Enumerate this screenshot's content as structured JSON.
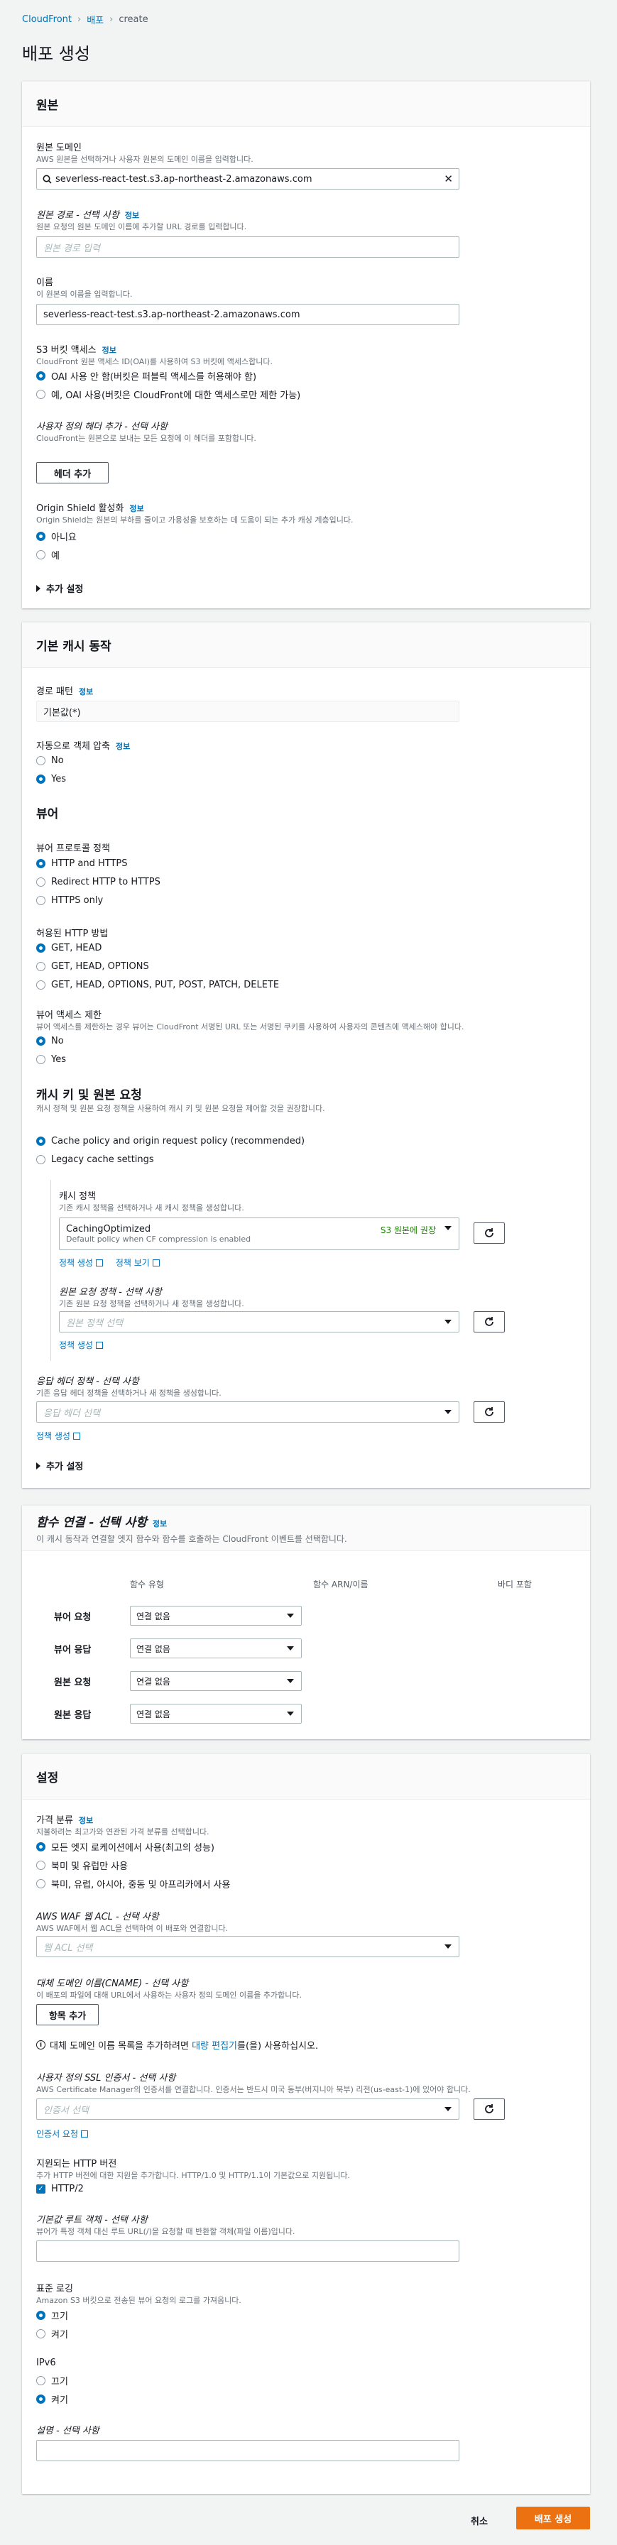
{
  "breadcrumb": {
    "items": [
      "CloudFront",
      "배포",
      "create"
    ]
  },
  "page_title": "배포 생성",
  "origin": {
    "title": "원본",
    "domain": {
      "label": "원본 도메인",
      "desc": "AWS 원본을 선택하거나 사용자 원본의 도메인 이름을 입력합니다.",
      "value": "severless-react-test.s3.ap-northeast-2.amazonaws.com"
    },
    "path": {
      "label": "원본 경로 - 선택 사항",
      "info": "정보",
      "desc": "원본 요청의 원본 도메인 이름에 추가할 URL 경로를 입력합니다.",
      "placeholder": "원본 경로 입력"
    },
    "name": {
      "label": "이름",
      "desc": "이 원본의 이름을 입력합니다.",
      "value": "severless-react-test.s3.ap-northeast-2.amazonaws.com"
    },
    "s3_access": {
      "label": "S3 버킷 액세스",
      "info": "정보",
      "desc": "CloudFront 원본 액세스 ID(OAI)를 사용하여 S3 버킷에 액세스합니다.",
      "options": [
        "OAI 사용 안 함(버킷은 퍼블릭 액세스를 허용해야 함)",
        "예, OAI 사용(버킷은 CloudFront에 대한 액세스로만 제한 가능)"
      ]
    },
    "headers": {
      "label": "사용자 정의 헤더 추가 - 선택 사항",
      "desc": "CloudFront는 원본으로 보내는 모든 요청에 이 헤더를 포함합니다.",
      "button": "헤더 추가"
    },
    "shield": {
      "label": "Origin Shield 활성화",
      "info": "정보",
      "desc": "Origin Shield는 원본의 부하를 줄이고 가용성을 보호하는 데 도움이 되는 추가 캐싱 계층입니다.",
      "options": [
        "아니요",
        "예"
      ]
    },
    "more": "추가 설정"
  },
  "cache": {
    "title": "기본 캐시 동작",
    "path_pattern": {
      "label": "경로 패턴",
      "info": "정보",
      "value": "기본값(*)"
    },
    "compress": {
      "label": "자동으로 객체 압축",
      "info": "정보",
      "options": [
        "No",
        "Yes"
      ]
    },
    "viewer_title": "뷰어",
    "protocol": {
      "label": "뷰어 프로토콜 정책",
      "options": [
        "HTTP and HTTPS",
        "Redirect HTTP to HTTPS",
        "HTTPS only"
      ]
    },
    "methods": {
      "label": "허용된 HTTP 방법",
      "options": [
        "GET, HEAD",
        "GET, HEAD, OPTIONS",
        "GET, HEAD, OPTIONS, PUT, POST, PATCH, DELETE"
      ]
    },
    "restrict": {
      "label": "뷰어 액세스 제한",
      "desc": "뷰어 액세스를 제한하는 경우 뷰어는 CloudFront 서명된 URL 또는 서명된 쿠키를 사용하여 사용자의 콘텐츠에 액세스해야 합니다.",
      "options": [
        "No",
        "Yes"
      ]
    },
    "key_title": "캐시 키 및 원본 요청",
    "key_desc": "캐시 정책 및 원본 요청 정책을 사용하여 캐시 키 및 원본 요청을 제어할 것을 권장합니다.",
    "key_options": [
      "Cache policy and origin request policy (recommended)",
      "Legacy cache settings"
    ],
    "cache_policy": {
      "label": "캐시 정책",
      "desc": "기존 캐시 정책을 선택하거나 새 캐시 정책을 생성합니다.",
      "value": "CachingOptimized",
      "value_desc": "Default policy when CF compression is enabled",
      "badge": "S3 원본에 권장",
      "links": [
        "정책 생성",
        "정책 보기"
      ]
    },
    "origin_policy": {
      "label": "원본 요청 정책 - 선택 사항",
      "desc": "기존 원본 요청 정책을 선택하거나 새 정책을 생성합니다.",
      "placeholder": "원본 정책 선택",
      "link": "정책 생성"
    },
    "resp_policy": {
      "label": "응답 헤더 정책 - 선택 사항",
      "desc": "기존 응답 헤더 정책을 선택하거나 새 정책을 생성합니다.",
      "placeholder": "응답 헤더 선택",
      "link": "정책 생성"
    },
    "more": "추가 설정"
  },
  "functions": {
    "title": "함수 연결 - 선택 사항",
    "info": "정보",
    "desc": "이 캐시 동작과 연결할 엣지 함수와 함수를 호출하는 CloudFront 이벤트를 선택합니다.",
    "columns": [
      "함수 유형",
      "함수 ARN/이름",
      "바디 포함"
    ],
    "rows": [
      {
        "label": "뷰어 요청",
        "value": "연결 없음"
      },
      {
        "label": "뷰어 응답",
        "value": "연결 없음"
      },
      {
        "label": "원본 요청",
        "value": "연결 없음"
      },
      {
        "label": "원본 응답",
        "value": "연결 없음"
      }
    ]
  },
  "settings": {
    "title": "설정",
    "price": {
      "label": "가격 분류",
      "info": "정보",
      "desc": "지불하려는 최고가와 연관된 가격 분류를 선택합니다.",
      "options": [
        "모든 엣지 로케이션에서 사용(최고의 성능)",
        "북미 및 유럽만 사용",
        "북미, 유럽, 아시아, 중동 및 아프리카에서 사용"
      ]
    },
    "waf": {
      "label": "AWS WAF 웹 ACL - 선택 사항",
      "desc": "AWS WAF에서 웹 ACL을 선택하여 이 배포와 연결합니다.",
      "placeholder": "웹 ACL 선택"
    },
    "cname": {
      "label": "대체 도메인 이름(CNAME) - 선택 사항",
      "desc": "이 배포의 파일에 대해 URL에서 사용하는 사용자 정의 도메인 이름을 추가합니다.",
      "button": "항목 추가",
      "note_pre": "대체 도메인 이름 목록을 추가하려면 ",
      "note_link": "대량 편집기",
      "note_post": "를(을) 사용하십시오."
    },
    "ssl": {
      "label": "사용자 정의 SSL 인증서 - 선택 사항",
      "desc": "AWS Certificate Manager의 인증서를 연결합니다. 인증서는 반드시 미국 동부(버지니아 북부) 리전(us-east-1)에 있어야 합니다.",
      "placeholder": "인증서 선택",
      "link": "인증서 요청"
    },
    "http": {
      "label": "지원되는 HTTP 버전",
      "desc": "추가 HTTP 버전에 대한 지원을 추가합니다. HTTP/1.0 및 HTTP/1.1이 기본값으로 지원됩니다.",
      "check": "HTTP/2"
    },
    "root": {
      "label": "기본값 루트 객체 - 선택 사항",
      "desc": "뷰어가 특정 객체 대신 루트 URL(/)을 요청할 때 반환할 객체(파일 이름)입니다."
    },
    "logging": {
      "label": "표준 로깅",
      "desc": "Amazon S3 버킷으로 전송된 뷰어 요청의 로그를 가져옵니다.",
      "options": [
        "끄기",
        "켜기"
      ]
    },
    "ipv6": {
      "label": "IPv6",
      "options": [
        "끄기",
        "켜기"
      ]
    },
    "description": {
      "label": "설명 - 선택 사항"
    }
  },
  "footer": {
    "cancel": "취소",
    "submit": "배포 생성"
  },
  "colors": {
    "accent": "#0073bb",
    "primary_button": "#ec7211",
    "badge": "#1d8102"
  }
}
